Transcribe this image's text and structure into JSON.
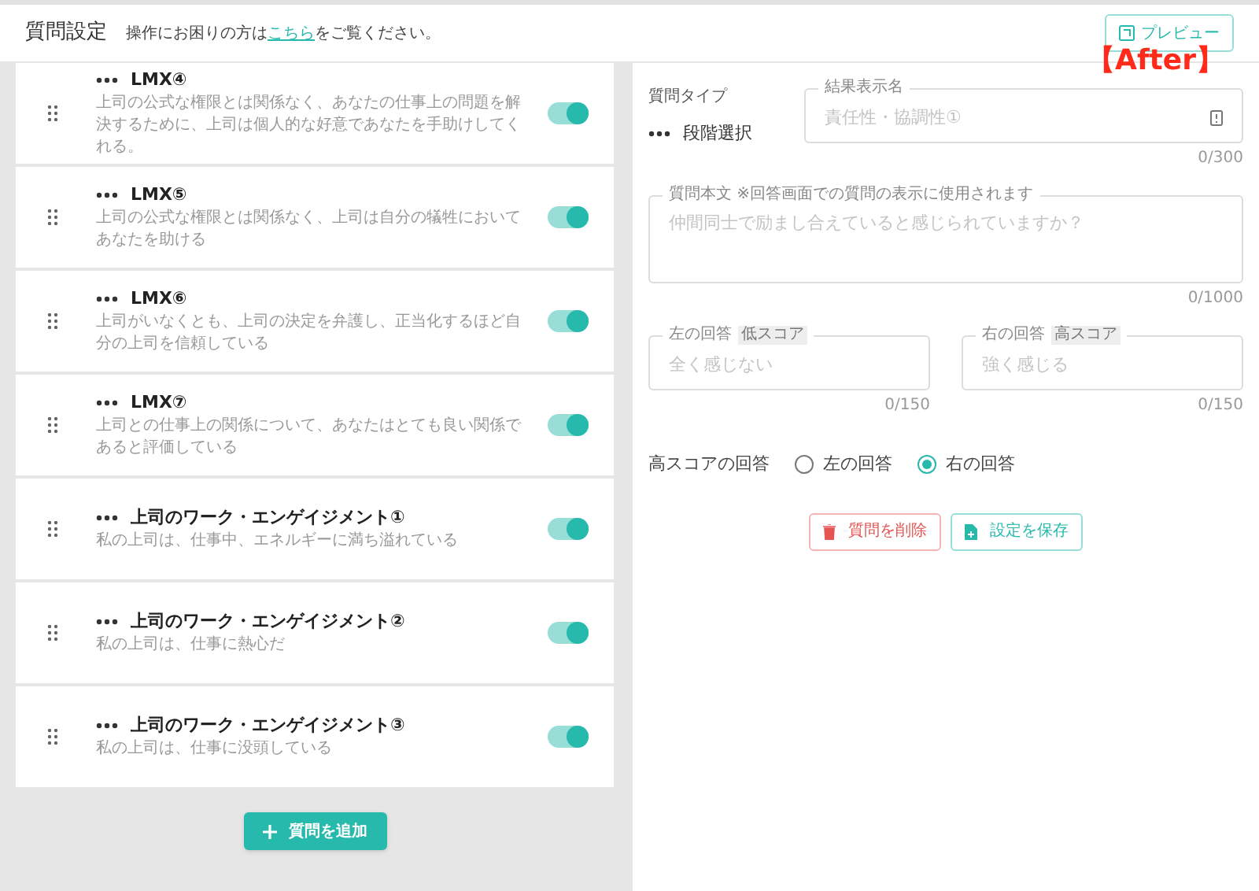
{
  "header": {
    "title": "質問設定",
    "help_before": "操作にお困りの方は",
    "help_link": "こちら",
    "help_after": "をご覧ください。",
    "preview_button": "プレビュー"
  },
  "annotation": "【After】",
  "questions": [
    {
      "title": "LMX④",
      "description": "上司の公式な権限とは関係なく、あなたの仕事上の問題を解決するために、上司は個人的な好意であなたを手助けしてくれる。",
      "enabled": true
    },
    {
      "title": "LMX⑤",
      "description": "上司の公式な権限とは関係なく、上司は自分の犠牲においてあなたを助ける",
      "enabled": true
    },
    {
      "title": "LMX⑥",
      "description": "上司がいなくとも、上司の決定を弁護し、正当化するほど自分の上司を信頼している",
      "enabled": true
    },
    {
      "title": "LMX⑦",
      "description": "上司との仕事上の関係について、あなたはとても良い関係であると評価している",
      "enabled": true
    },
    {
      "title": "上司のワーク・エンゲイジメント①",
      "description": "私の上司は、仕事中、エネルギーに満ち溢れている",
      "enabled": true
    },
    {
      "title": "上司のワーク・エンゲイジメント②",
      "description": "私の上司は、仕事に熱心だ",
      "enabled": true
    },
    {
      "title": "上司のワーク・エンゲイジメント③",
      "description": "私の上司は、仕事に没頭している",
      "enabled": true
    }
  ],
  "add_button": "質問を追加",
  "editor": {
    "question_type_label": "質問タイプ",
    "question_type": "段階選択",
    "result_name": {
      "label": "結果表示名",
      "placeholder": "責任性・協調性①",
      "counter": "0/300"
    },
    "body": {
      "label": "質問本文 ※回答画面での質問の表示に使用されます",
      "placeholder": "仲間同士で励まし合えていると感じられていますか？",
      "counter": "0/1000"
    },
    "answers": [
      {
        "label": "左の回答",
        "tag": "低スコア",
        "placeholder": "全く感じない",
        "counter": "0/150"
      },
      {
        "label": "右の回答",
        "tag": "高スコア",
        "placeholder": "強く感じる",
        "counter": "0/150"
      }
    ],
    "high_score_label": "高スコアの回答",
    "high_score_options": [
      {
        "label": "左の回答",
        "selected": false
      },
      {
        "label": "右の回答",
        "selected": true
      }
    ],
    "delete_button": "質問を削除",
    "save_button": "設定を保存"
  }
}
